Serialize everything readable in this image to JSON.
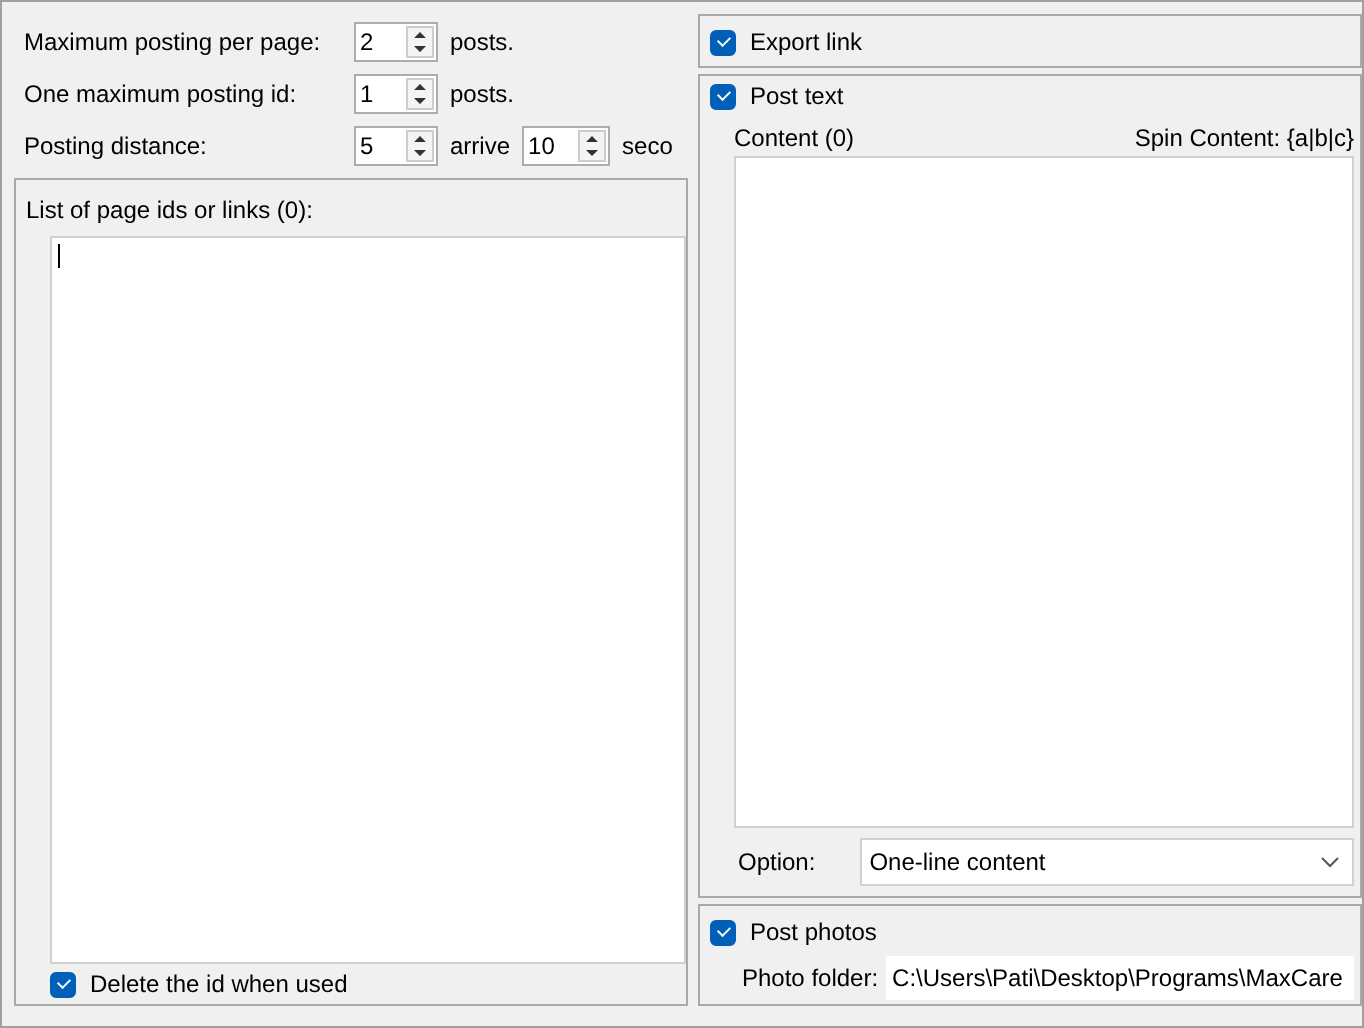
{
  "settings": [
    {
      "label": "Maximum posting per page:",
      "value": "2",
      "unit": "posts."
    },
    {
      "label": "One maximum posting id:",
      "value": "1",
      "unit": "posts."
    },
    {
      "label": "Posting distance:",
      "value": "5",
      "unit": "arrive",
      "value2": "10",
      "unit2": "seco"
    }
  ],
  "page_list": {
    "title": "List of page ids or links (0):",
    "delete_when_used": {
      "label": "Delete the id when used",
      "checked": true
    }
  },
  "export_link": {
    "label": "Export link",
    "checked": true
  },
  "post_text": {
    "label": "Post text",
    "checked": true,
    "content_label": "Content (0)",
    "spin_hint": "Spin Content: {a|b|c}",
    "option_label": "Option:",
    "option_value": "One-line content"
  },
  "post_photos": {
    "label": "Post photos",
    "checked": true,
    "folder_label": "Photo folder:",
    "folder_value": "C:\\Users\\Pati\\Desktop\\Programs\\MaxCare"
  }
}
